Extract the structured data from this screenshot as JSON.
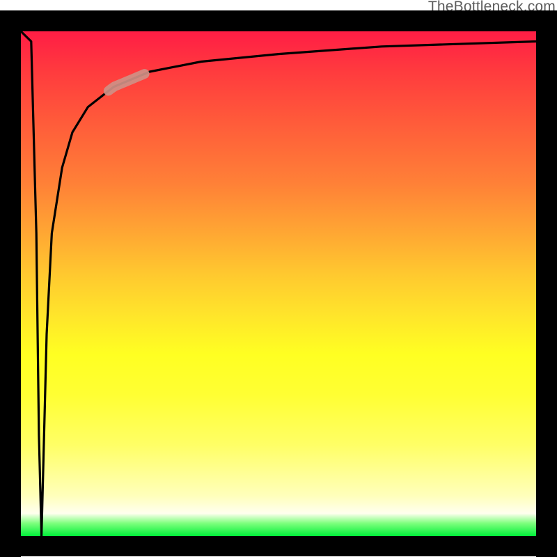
{
  "watermark": "TheBottleneck.com",
  "colors": {
    "border": "#000000",
    "curve": "#000000",
    "highlight": "#cf9086"
  },
  "chart_data": {
    "type": "line",
    "title": "",
    "xlabel": "",
    "ylabel": "",
    "xlim": [
      0,
      100
    ],
    "ylim": [
      0,
      100
    ],
    "grid": false,
    "legend": false,
    "series": [
      {
        "name": "curve",
        "x": [
          0,
          2,
          3,
          3.5,
          4,
          5,
          6,
          8,
          10,
          13,
          18,
          25,
          35,
          50,
          70,
          100
        ],
        "y": [
          100,
          98,
          60,
          20,
          0,
          40,
          60,
          73,
          80,
          85,
          89,
          92,
          94,
          95.5,
          97,
          98
        ]
      }
    ],
    "highlight_segment": {
      "series": "curve",
      "x_start": 17,
      "x_end": 24
    }
  }
}
